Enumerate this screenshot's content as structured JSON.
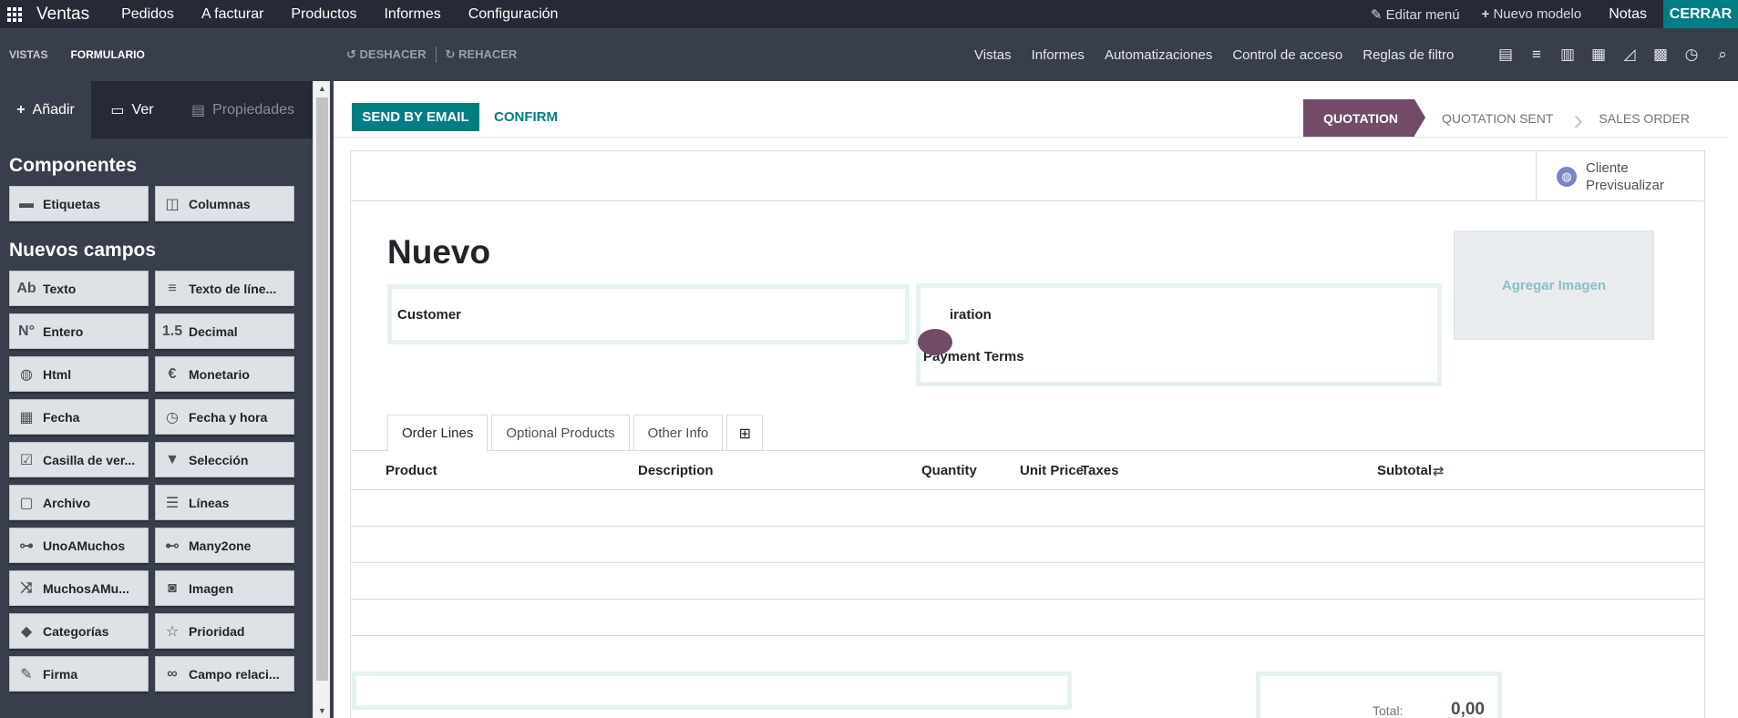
{
  "topbar": {
    "app_name": "Ventas",
    "menu": [
      "Pedidos",
      "A facturar",
      "Productos",
      "Informes",
      "Configuración"
    ],
    "edit_menu": "Editar menú",
    "new_model": "Nuevo modelo",
    "notes": "Notas",
    "close": "CERRAR"
  },
  "subbar": {
    "views": "VISTAS",
    "form": "FORMULARIO",
    "undo": "DESHACER",
    "redo": "REHACER",
    "menu": [
      "Vistas",
      "Informes",
      "Automatizaciones",
      "Control de acceso",
      "Reglas de filtro"
    ]
  },
  "sidebar": {
    "tabs": {
      "add": "Añadir",
      "view": "Ver",
      "properties": "Propiedades"
    },
    "components_title": "Componentes",
    "components": [
      {
        "label": "Etiquetas",
        "icon": "tabs-icon"
      },
      {
        "label": "Columnas",
        "icon": "columns-icon"
      }
    ],
    "new_fields_title": "Nuevos campos",
    "fields": [
      {
        "label": "Texto",
        "glyph": "Ab",
        "icon": "text-icon"
      },
      {
        "label": "Texto de líne...",
        "glyph": "≡",
        "icon": "multiline-text-icon"
      },
      {
        "label": "Entero",
        "glyph": "N°",
        "icon": "integer-icon"
      },
      {
        "label": "Decimal",
        "glyph": "1.5",
        "icon": "decimal-icon"
      },
      {
        "label": "Html",
        "glyph": "◍",
        "icon": "html-icon"
      },
      {
        "label": "Monetario",
        "glyph": "€",
        "icon": "monetary-icon"
      },
      {
        "label": "Fecha",
        "glyph": "▦",
        "icon": "date-icon"
      },
      {
        "label": "Fecha y hora",
        "glyph": "◷",
        "icon": "datetime-icon"
      },
      {
        "label": "Casilla de ver...",
        "glyph": "☑",
        "icon": "checkbox-icon"
      },
      {
        "label": "Selección",
        "glyph": "▼",
        "icon": "selection-icon"
      },
      {
        "label": "Archivo",
        "glyph": "▢",
        "icon": "file-icon"
      },
      {
        "label": "Líneas",
        "glyph": "☰",
        "icon": "lines-icon"
      },
      {
        "label": "UnoAMuchos",
        "glyph": "⊶",
        "icon": "one2many-icon"
      },
      {
        "label": "Many2one",
        "glyph": "⊷",
        "icon": "many2one-icon"
      },
      {
        "label": "MuchosAMu...",
        "glyph": "⤨",
        "icon": "many2many-icon"
      },
      {
        "label": "Imagen",
        "glyph": "◙",
        "icon": "image-icon"
      },
      {
        "label": "Categorías",
        "glyph": "◆",
        "icon": "tags-icon"
      },
      {
        "label": "Prioridad",
        "glyph": "☆",
        "icon": "priority-icon"
      },
      {
        "label": "Firma",
        "glyph": "✎",
        "icon": "signature-icon"
      },
      {
        "label": "Campo relaci...",
        "glyph": "∞",
        "icon": "related-field-icon"
      }
    ]
  },
  "form": {
    "send_by_email": "SEND BY EMAIL",
    "confirm": "CONFIRM",
    "stages": [
      "QUOTATION",
      "QUOTATION SENT",
      "SALES ORDER"
    ],
    "preview_line1": "Cliente",
    "preview_line2": "Previsualizar",
    "title": "Nuevo",
    "add_image": "Agregar Imagen",
    "customer_label": "Customer",
    "expiration_label": "iration",
    "payment_terms_label": "Payment Terms",
    "tabs": [
      "Order Lines",
      "Optional Products",
      "Other Info"
    ],
    "columns": [
      "Product",
      "Description",
      "Quantity",
      "Unit Price",
      "Taxes",
      "Subtotal"
    ],
    "total_label": "Total:",
    "total_value": "0,00"
  },
  "colors": {
    "brand": "#714b67",
    "teal": "#017e84",
    "dark": "#262a36"
  }
}
